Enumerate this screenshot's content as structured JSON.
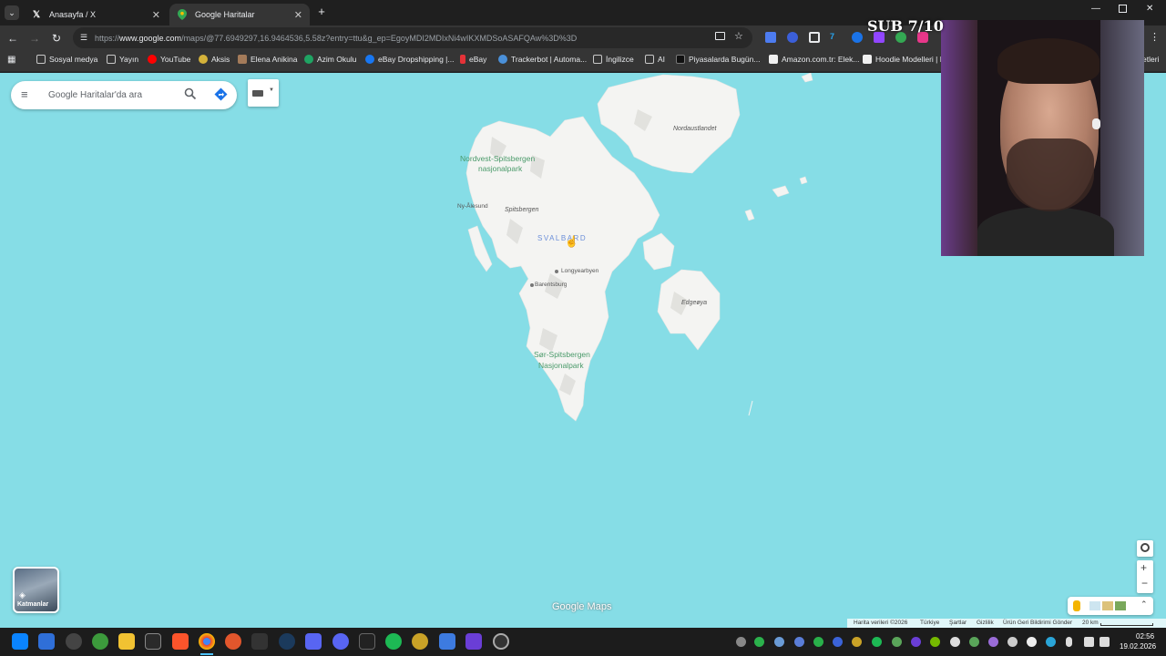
{
  "tabs": [
    {
      "title": "Anasayfa / X",
      "active": false
    },
    {
      "title": "Google Haritalar",
      "active": true
    }
  ],
  "omnibox": {
    "url_prefix": "https://",
    "host": "www.google.com",
    "path": "/maps/@77.6949297,16.9464536,5.58z?entry=ttu&g_ep=EgoyMDI2MDIxNi4wIKXMDSoASAFQAw%3D%3D"
  },
  "bookmarks": [
    "Sosyal medya",
    "Yayın",
    "YouTube",
    "Aksis",
    "Elena Anikina",
    "Azim Okulu",
    "eBay Dropshipping |...",
    "eBay",
    "Trackerbot | Automa...",
    "İngilizce",
    "AI",
    "Piyasalarda Bugün...",
    "Amazon.com.tr: Elek...",
    "Hoodie Modelleri | L...",
    "etleri"
  ],
  "maps": {
    "search_placeholder": "Google Haritalar'da ara",
    "layers_label": "Katmanlar",
    "logo_google": "Google",
    "logo_maps": "Maps",
    "labels": {
      "nordaustlandet": "Nordaustlandet",
      "nw_park_1": "Nordvest-Spitsbergen",
      "nw_park_2": "nasjonalpark",
      "ny_alesund": "Ny-Ålesund",
      "spitsbergen": "Spitsbergen",
      "svalbard": "SVALBARD",
      "longyearbyen": "Longyearbyen",
      "barentsburg": "Barentsburg",
      "edgeoya": "Edgeøya",
      "sor_park_1": "Sør-Spitsbergen",
      "sor_park_2": "Nasjonalpark"
    },
    "footer": {
      "map_data": "Harita verileri ©2026",
      "country": "Türkiye",
      "terms": "Şartlar",
      "privacy": "Gizlilik",
      "feedback": "Ürün Geri Bildirimi Gönder",
      "scale": "20 km"
    }
  },
  "stream": {
    "sub_goal": "SUB 7/10"
  },
  "clock": {
    "time": "02:56",
    "date": "19.02.2026"
  },
  "colors": {
    "water": "#86dde6",
    "land": "#f2f2f0",
    "park": "#4a9a6a",
    "accent": "#1a73e8"
  }
}
